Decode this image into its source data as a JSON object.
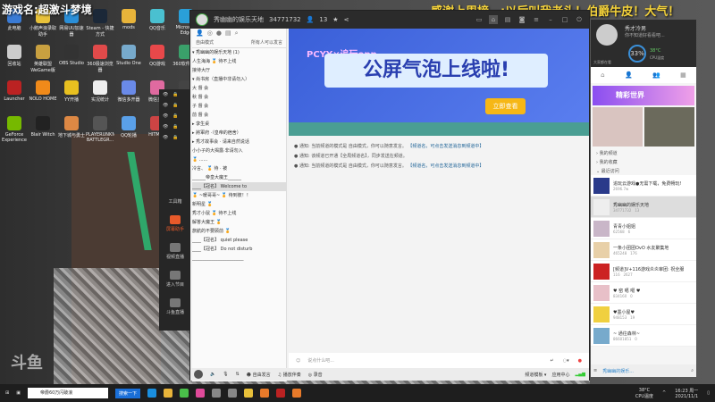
{
  "overlay": {
    "game_title": "游戏名:超激斗梦境",
    "thanks": "感谢上周榜一:以后叫我老头！伯爵牛皮！大气！",
    "watermark": "斗鱼"
  },
  "desktop_icons": [
    "此电脑",
    "小鹅声浪录取助手",
    "网易UU加速器",
    "Steam - 快捷方式",
    "mods",
    "QQ音乐",
    "Microsoft Edge",
    "回收站",
    "英雄联盟WeGame版",
    "OBS Studio",
    "360极速浏览器",
    "Studio One",
    "QQ游戏",
    "360软件管家",
    "Launcher",
    "NOLO HOME",
    "YY开播",
    "实况统计",
    "微信多开器",
    "微信多开",
    "",
    "GeForce Experience",
    "Blair Witch",
    "地下城与勇士",
    "PLAYERUNKNOWN'S BATTLEGR...",
    "QQ轮播",
    "HITMAN",
    ""
  ],
  "obs_panel": {
    "tools": [
      "工具箱",
      "屏幕助手",
      "视频直播",
      "进入节目",
      "斗鱼直播"
    ]
  },
  "header": {
    "room_name": "秀幽幽的娱乐天地",
    "room_id": "34771732",
    "online": "13"
  },
  "left": {
    "mode": "自由模式",
    "mode_hint": "所有人可以发言",
    "tree": [
      "▾ 秀幽幽的娱乐天地 (1)",
      "   人生海海 🏅 待不上线",
      "      接待大厅",
      "▾ 尚书房（直播中非请勿入）",
      "      大 督 会",
      "      秋 督 会",
      "      子 督 会",
      "      前 督 会",
      "▸ 孪生桌",
      "▸ 將軍府 ·（皇帝的宿舍）",
      "▸ 秀才故事会 · 请来自然说话",
      "   小小子的大揭露·非请勿入",
      "      🏅 ......",
      "      冷言、 🏅 待 · 被",
      "   ______帝皇大魔王______",
      "   ____【冠名】 Welcome to",
      "   🏅 ~暖哥哥~ 🏅 待到彼！！",
      "      新明星 🏅",
      "      秀才小鼠 🏅 待不上线",
      "      解答大魔王 🏅",
      "      旅航的不要顾前 🏅",
      "   ____【冠名】 quiet please",
      "   ____【冠名】 Do not disturb",
      "   _______________________"
    ]
  },
  "banner": {
    "subtitle": "PCYY×追玩opp",
    "title": "公屏气泡上线啦!",
    "button": "立即查看"
  },
  "chat": {
    "messages": [
      {
        "label": "通知:",
        "text": "当前频道的模式是 自由模式，你可以随意发言。",
        "tag": "【频道名，可点击发送消息到频道中】"
      },
      {
        "label": "通知:",
        "text": "该频道已开通【全局频道名】，同步发送在频道。",
        "tag": ""
      },
      {
        "label": "通知:",
        "text": "当前频道的模式是 自由模式，你可以随意发言。",
        "tag": "【频道名，可点击发送消息到频道中】"
      }
    ]
  },
  "input": {
    "placeholder": "说点什么吧..."
  },
  "bottom_bar": {
    "items": [
      "自由发言",
      "播放伴奏",
      "录音"
    ],
    "right": [
      "频道模板 ▾",
      "应用中心"
    ]
  },
  "right": {
    "user_name": "秀才冷男",
    "signature": "你不知道好看看吧...",
    "cpu": "33%",
    "temp": "38°C",
    "cpu_label": "CPU温度",
    "placeholder": "大家都在看",
    "banner": "精彩世界",
    "sections": [
      "我的频道",
      "我的收藏",
      "最近访问"
    ],
    "recent": [
      {
        "name": "追玩云游戏●无需下载，免费畅玩!",
        "stat1": "2696.7w",
        "stat2": ""
      },
      {
        "name": "秀幽幽的娱乐天地",
        "stat1": "34771732",
        "stat2": "13"
      },
      {
        "name": "青青小姐姐",
        "stat1": "62568",
        "stat2": "6"
      },
      {
        "name": "一条小团团OvO 水友聚集地",
        "stat1": "465248",
        "stat2": "176"
      },
      {
        "name": "[频道]V+116游戏炎炎审团: 祝全服",
        "stat1": "116",
        "stat2": "2627"
      },
      {
        "name": "♥ 窑 噶 噶 ♥",
        "stat1": "834160",
        "stat2": "0"
      },
      {
        "name": "♥墨小屋♥",
        "stat1": "948153",
        "stat2": "19"
      },
      {
        "name": "~ 通往森林~",
        "stat1": "86601851",
        "stat2": "0"
      }
    ],
    "bottom": "秀幽幽的娱乐..."
  },
  "taskbar": {
    "search": "帝爵60万闪破浪",
    "search_btn": "搜索一下",
    "temp": "38°C",
    "cpu_label": "CPU温度",
    "time": "16:23 周一",
    "date": "2021/11/1"
  }
}
